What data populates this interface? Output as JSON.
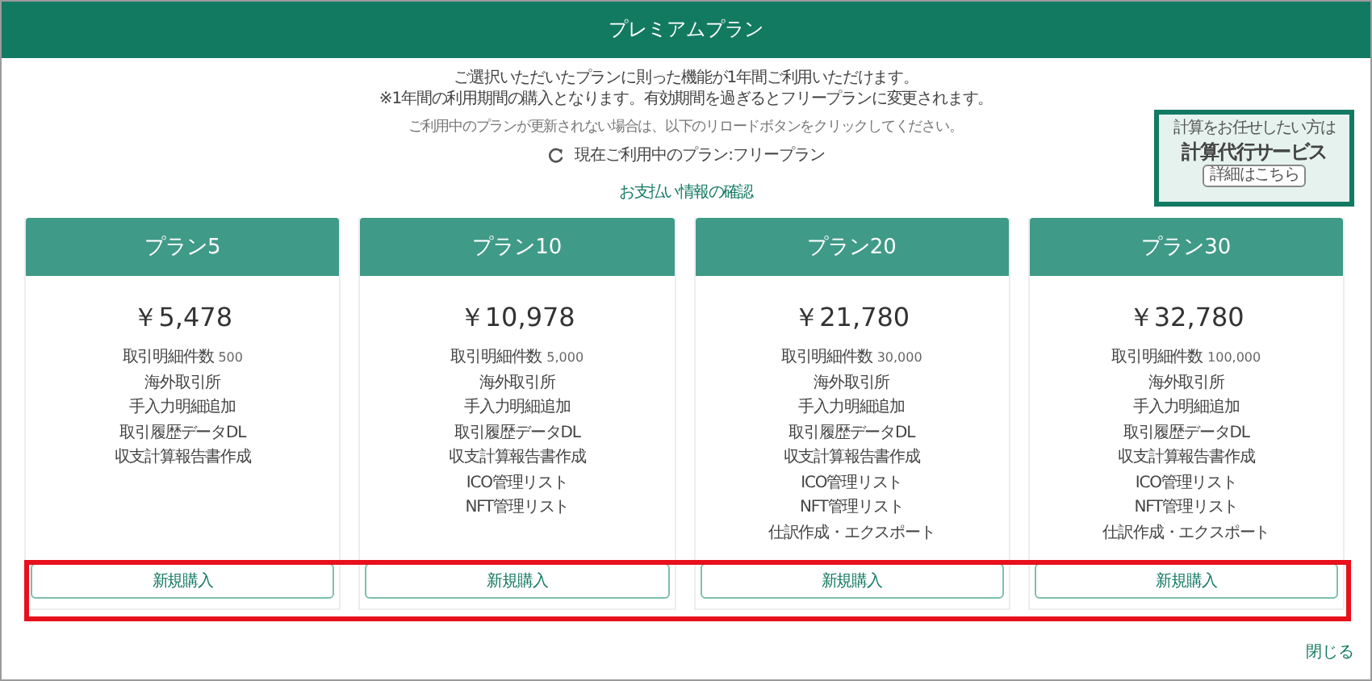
{
  "dialog": {
    "title": "プレミアムプラン"
  },
  "intro": {
    "lines": [
      "ご選択いただいたプランに則った機能が1年間ご利用いただけます。",
      "※1年間の利用期間の購入となります。有効期間を過ぎるとフリープランに変更されます。"
    ],
    "reload_note": "ご利用中のプランが更新されない場合は、以下のリロードボタンをクリックしてください。",
    "current_plan": "現在ご利用中のプラン:フリープラン",
    "payment_link": "お支払い情報の確認"
  },
  "promo": {
    "lead": "計算をお任せしたい方は",
    "title": "計算代行サービス",
    "button": "詳細はこちら"
  },
  "plans": [
    {
      "name": "プラン5",
      "price": "￥5,478",
      "limit_label": "取引明細件数",
      "limit": "500",
      "features": [
        "海外取引所",
        "手入力明細追加",
        "取引履歴データDL",
        "収支計算報告書作成"
      ],
      "button": "新規購入"
    },
    {
      "name": "プラン10",
      "price": "￥10,978",
      "limit_label": "取引明細件数",
      "limit": "5,000",
      "features": [
        "海外取引所",
        "手入力明細追加",
        "取引履歴データDL",
        "収支計算報告書作成",
        "ICO管理リスト",
        "NFT管理リスト"
      ],
      "button": "新規購入"
    },
    {
      "name": "プラン20",
      "price": "￥21,780",
      "limit_label": "取引明細件数",
      "limit": "30,000",
      "features": [
        "海外取引所",
        "手入力明細追加",
        "取引履歴データDL",
        "収支計算報告書作成",
        "ICO管理リスト",
        "NFT管理リスト",
        "仕訳作成・エクスポート"
      ],
      "button": "新規購入"
    },
    {
      "name": "プラン30",
      "price": "￥32,780",
      "limit_label": "取引明細件数",
      "limit": "100,000",
      "features": [
        "海外取引所",
        "手入力明細追加",
        "取引履歴データDL",
        "収支計算報告書作成",
        "ICO管理リスト",
        "NFT管理リスト",
        "仕訳作成・エクスポート"
      ],
      "button": "新規購入"
    }
  ],
  "close": "閉じる"
}
